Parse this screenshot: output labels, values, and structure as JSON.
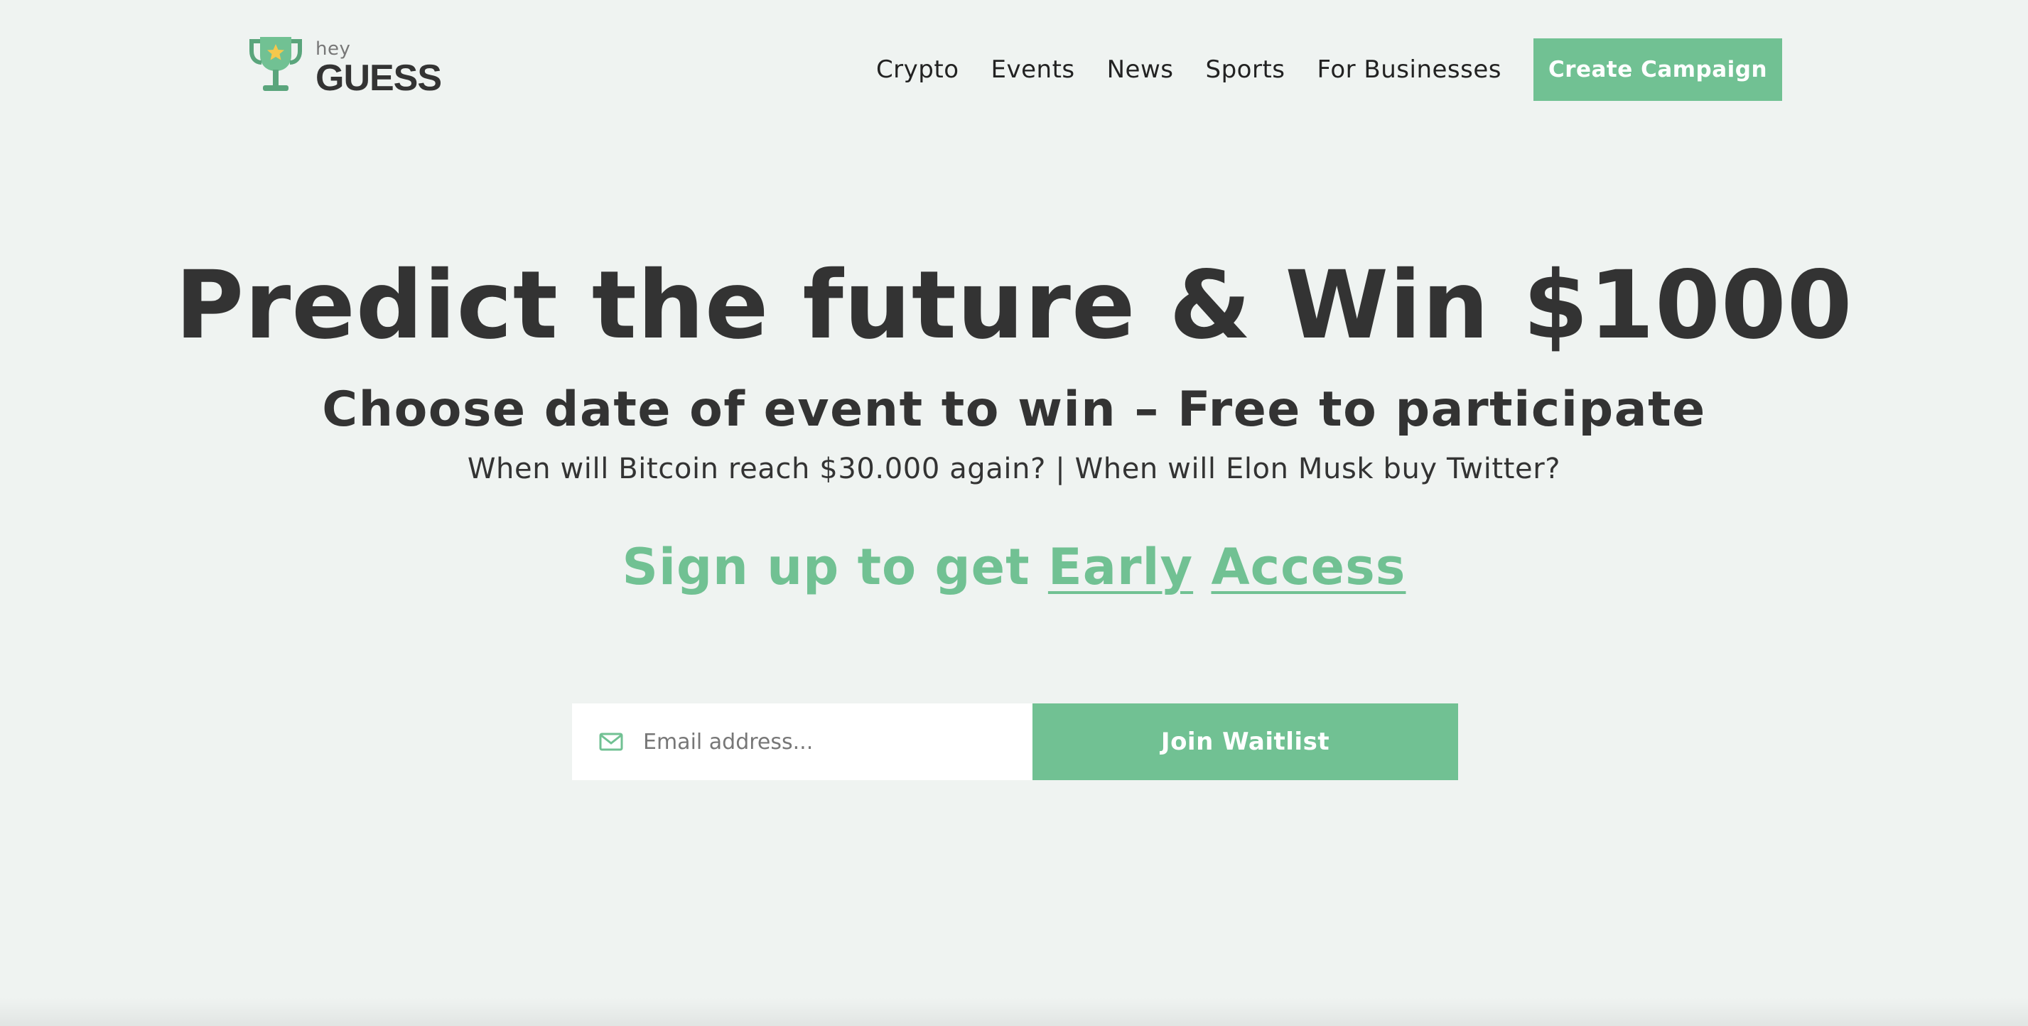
{
  "brand": {
    "small": "hey",
    "name": "GUESS",
    "logo_icon": "trophy-icon",
    "colors": {
      "primary": "#71c193",
      "star": "#f5c84c",
      "text": "#333333",
      "background": "#eff3f1"
    }
  },
  "nav": {
    "items": [
      {
        "label": "Crypto"
      },
      {
        "label": "Events"
      },
      {
        "label": "News"
      },
      {
        "label": "Sports"
      },
      {
        "label": "For Businesses"
      }
    ],
    "cta_label": "Create Campaign"
  },
  "hero": {
    "title": "Predict the future & Win $1000",
    "subtitle": "Choose date of event to win – Free to participate",
    "questions": "When will Bitcoin reach $30.000 again? | When will Elon Musk buy Twitter?",
    "signup_prefix": "Sign up to get ",
    "signup_link1": "Early",
    "signup_link2": "Access"
  },
  "form": {
    "email_icon": "mail-icon",
    "email_placeholder": "Email address...",
    "email_value": "",
    "submit_label": "Join Waitlist"
  }
}
